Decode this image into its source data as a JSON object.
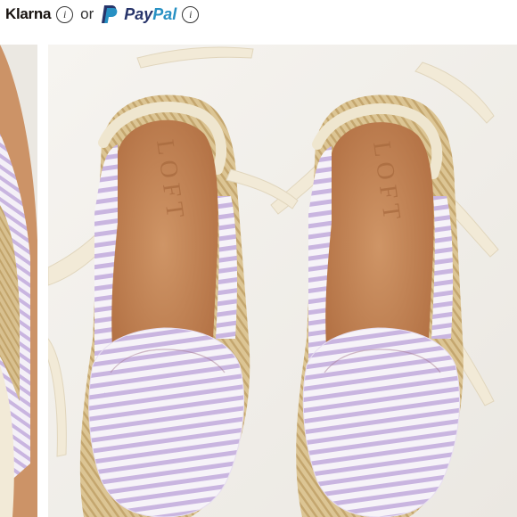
{
  "payment_options": {
    "klarna_label": "Klarna",
    "or_text": "or",
    "paypal_label_a": "Pay",
    "paypal_label_b": "Pal",
    "info_glyph": "i"
  },
  "photo": {
    "brand_imprint": "LOFT",
    "colors": {
      "background": "#f3f1ec",
      "stripe_lavender": "#c9b5e0",
      "insole": "#c98a5a",
      "jute": "#d8c08f",
      "ribbon": "#f2ead7"
    }
  }
}
